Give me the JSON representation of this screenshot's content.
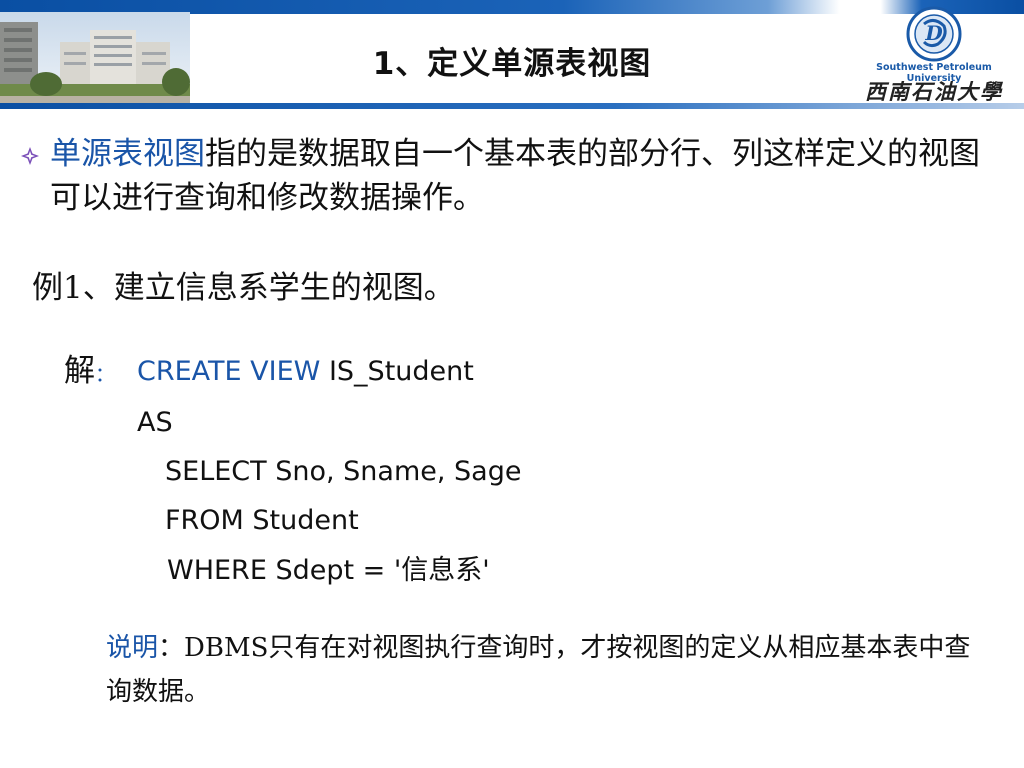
{
  "header": {
    "title": "1、定义单源表视图",
    "logo": {
      "english_name": "Southwest Petroleum University",
      "chinese_name": "西南石油大學",
      "emblem_letter": "D"
    }
  },
  "bullet": {
    "highlight": "单源表视图",
    "rest": "指的是数据取自一个基本表的部分行、列这样定义的视图可以进行查询和修改数据操作。"
  },
  "example": {
    "text": "例1、建立信息系学生的视图。"
  },
  "solution": {
    "label": "解",
    "colon": "：",
    "code": {
      "line1_keyword": "CREATE VIEW",
      "line1_name": " IS_Student",
      "line2": "AS",
      "line3": "SELECT Sno, Sname, Sage",
      "line4": "FROM Student",
      "line5": "WHERE Sdept = '信息系'"
    }
  },
  "note": {
    "label": "说明",
    "text": "：DBMS只有在对视图执行查询时，才按视图的定义从相应基本表中查询数据。"
  },
  "colors": {
    "accent": "#1a55a8",
    "header_band": "#0a4fa3",
    "bullet_marker": "#7a4fb8"
  }
}
